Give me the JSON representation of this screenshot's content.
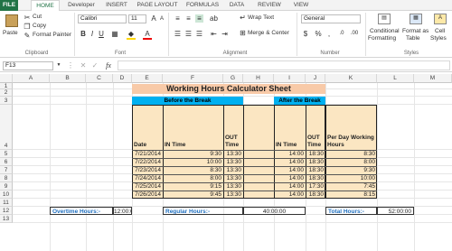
{
  "tabs": [
    "FILE",
    "HOME",
    "Developer",
    "INSERT",
    "PAGE LAYOUT",
    "FORMULAS",
    "DATA",
    "REVIEW",
    "VIEW"
  ],
  "clipboard": {
    "paste": "Paste",
    "cut": "Cut",
    "copy": "Copy",
    "format_painter": "Format Painter",
    "group": "Clipboard"
  },
  "font": {
    "name": "Calibri",
    "size": "11",
    "bold": "B",
    "italic": "I",
    "underline": "U",
    "group": "Font"
  },
  "alignment": {
    "wrap_text": "Wrap Text",
    "merge_center": "Merge & Center",
    "group": "Alignment"
  },
  "number": {
    "format": "General",
    "currency": "$",
    "percent": "%",
    "comma": ",",
    "group": "Number"
  },
  "styles": {
    "conditional": "Conditional",
    "conditional2": "Formatting",
    "format_as": "Format as",
    "table": "Table",
    "cell": "Cell",
    "styles_label": "Styles",
    "group": "Styles"
  },
  "formula_bar": {
    "name_box": "F13",
    "fx": "fx",
    "value": ""
  },
  "columns": [
    "A",
    "B",
    "C",
    "D",
    "E",
    "F",
    "G",
    "H",
    "I",
    "J",
    "K",
    "L",
    "M"
  ],
  "rows": [
    "1",
    "2",
    "3",
    "4",
    "5",
    "6",
    "7",
    "8",
    "9",
    "10",
    "11",
    "12",
    "13"
  ],
  "sheet": {
    "title": "Working Hours Calculator Sheet",
    "before_break": "Before the Break",
    "after_break": "After the Break",
    "headers": {
      "date": "Date",
      "in1": "IN Time",
      "out1": "OUT Time",
      "in2": "IN Time",
      "out2": "OUT Time",
      "perday": "Per Day Working Hours"
    },
    "records": [
      {
        "date": "7/21/2014",
        "in1": "9:30",
        "out1": "13:30",
        "in2": "14:00",
        "out2": "18:30",
        "total": "8:30"
      },
      {
        "date": "7/22/2014",
        "in1": "10:00",
        "out1": "13:30",
        "in2": "14:00",
        "out2": "18:30",
        "total": "8:00"
      },
      {
        "date": "7/23/2014",
        "in1": "8:30",
        "out1": "13:30",
        "in2": "14:00",
        "out2": "18:30",
        "total": "9:30"
      },
      {
        "date": "7/24/2014",
        "in1": "8:00",
        "out1": "13:30",
        "in2": "14:00",
        "out2": "18:30",
        "total": "10:00"
      },
      {
        "date": "7/25/2014",
        "in1": "9:15",
        "out1": "13:30",
        "in2": "14:00",
        "out2": "17:30",
        "total": "7:45"
      },
      {
        "date": "7/26/2014",
        "in1": "9:45",
        "out1": "13:30",
        "in2": "14:00",
        "out2": "18:30",
        "total": "8:15"
      }
    ],
    "overtime_label": "Overtime Hours:-",
    "overtime_value": "12:00:00",
    "regular_label": "Regular Hours:-",
    "regular_value": "40:00:00",
    "total_label": "Total Hours:-",
    "total_value": "52:00:00"
  },
  "colors": {
    "excel_green": "#217346",
    "title_fill": "#f8caa8",
    "banner_blue": "#00b0f0",
    "table_fill": "#fbe6c2",
    "label_blue": "#1f6fbf"
  }
}
